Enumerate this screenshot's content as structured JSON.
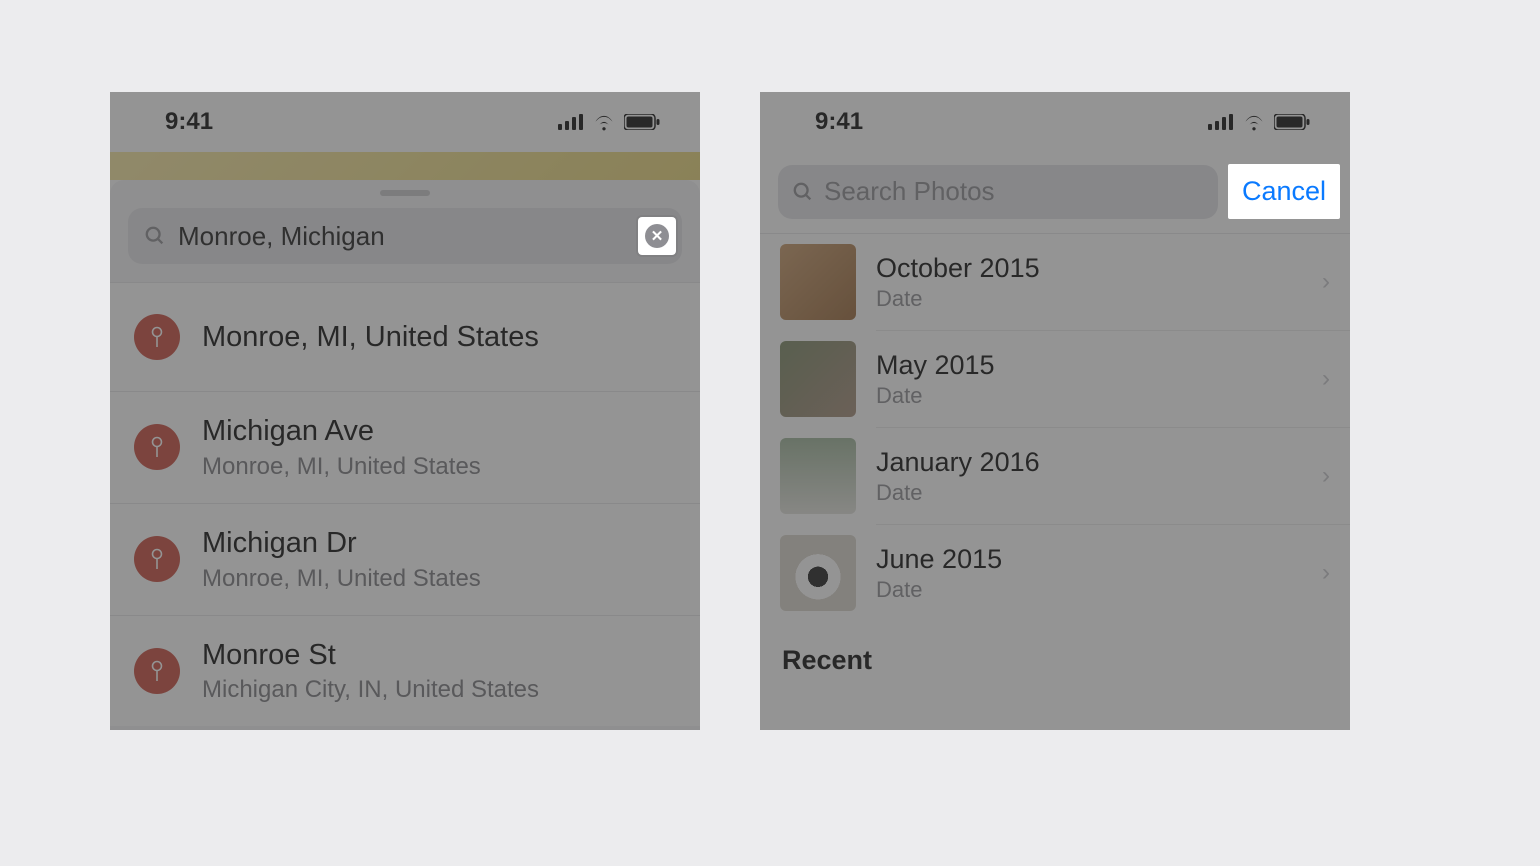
{
  "status_bar": {
    "time": "9:41"
  },
  "left_phone": {
    "search_value": "Monroe, Michigan",
    "results": [
      {
        "title": "Monroe, MI, United States",
        "sub": ""
      },
      {
        "title": "Michigan Ave",
        "sub": "Monroe, MI, United States"
      },
      {
        "title": "Michigan Dr",
        "sub": "Monroe, MI, United States"
      },
      {
        "title": "Monroe St",
        "sub": "Michigan City, IN, United States"
      }
    ]
  },
  "right_phone": {
    "search_placeholder": "Search Photos",
    "cancel_label": "Cancel",
    "suggestions": [
      {
        "title": "October 2015",
        "sub": "Date"
      },
      {
        "title": "May 2015",
        "sub": "Date"
      },
      {
        "title": "January 2016",
        "sub": "Date"
      },
      {
        "title": "June 2015",
        "sub": "Date"
      }
    ],
    "recent_header": "Recent"
  }
}
